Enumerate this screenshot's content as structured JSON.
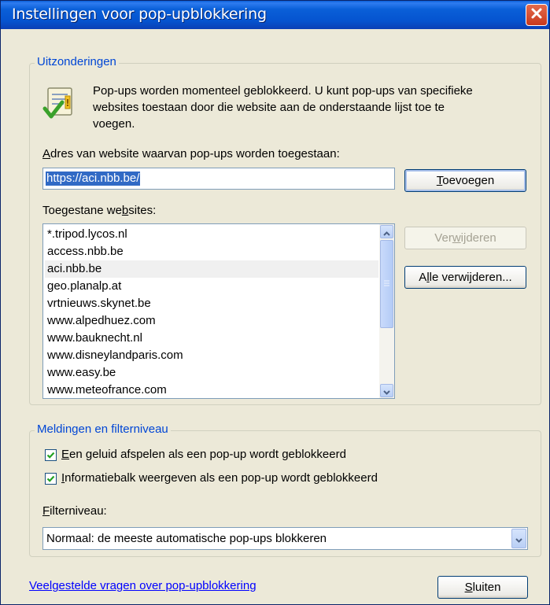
{
  "window": {
    "title": "Instellingen voor pop-upblokkering",
    "close_label": "×"
  },
  "exceptions": {
    "legend": "Uitzonderingen",
    "info_lines": [
      "Pop-ups worden momenteel geblokkeerd. U kunt pop-ups van specifieke",
      "websites toestaan door die website aan de onderstaande lijst toe te",
      "voegen."
    ],
    "address_label": "Adres van website waarvan pop-ups worden toegestaan:",
    "address_value": "https://aci.nbb.be/",
    "add_button": "Toevoegen",
    "allowed_label": "Toegestane websites:",
    "allowed_sites": [
      "*.tripod.lycos.nl",
      "access.nbb.be",
      "aci.nbb.be",
      "geo.planalp.at",
      "vrtnieuws.skynet.be",
      "www.alpedhuez.com",
      "www.bauknecht.nl",
      "www.disneylandparis.com",
      "www.easy.be",
      "www.meteofrance.com"
    ],
    "selected_site": "aci.nbb.be",
    "remove_button": "Verwijderen",
    "remove_all_button": "Alle verwijderen..."
  },
  "notifications": {
    "legend": "Meldingen en filterniveau",
    "play_sound_label": "Een geluid afspelen als een pop-up wordt geblokkeerd",
    "play_sound_checked": true,
    "show_infobar_label": "Informatiebalk weergeven als een pop-up wordt geblokkeerd",
    "show_infobar_checked": true,
    "filter_level_label": "Filterniveau:",
    "filter_level_value": "Normaal: de meeste automatische pop-ups blokkeren"
  },
  "footer": {
    "faq_link": "Veelgestelde vragen over pop-upblokkering",
    "close_button": "Sluiten"
  },
  "colors": {
    "titlebar": "#0a5fd8",
    "dialog_bg": "#ece9d8",
    "legend_text": "#0046d5",
    "link": "#0000ff",
    "selection": "#316ac5"
  },
  "icons": {
    "info": "shield-check-icon",
    "close": "close-icon",
    "scroll_up": "chevron-up-icon",
    "scroll_down": "chevron-down-icon",
    "dropdown": "chevron-down-icon",
    "checkbox": "checkmark-icon"
  }
}
